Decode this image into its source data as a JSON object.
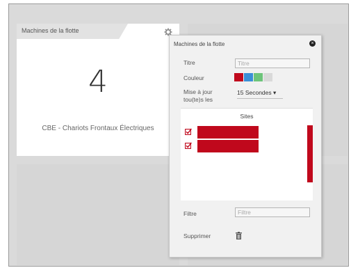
{
  "widget": {
    "title": "Machines de la flotte",
    "value": "4",
    "caption": "CBE - Chariots Frontaux Électriques",
    "settings_icon": "gear-icon"
  },
  "settings": {
    "title": "Machines de la flotte",
    "close_icon": "close-icon",
    "fields": {
      "titre_label": "Titre",
      "titre_placeholder": "Titre",
      "couleur_label": "Couleur",
      "update_label_line1": "Mise à jour",
      "update_label_line2": "tou(te)s les",
      "update_value": "15 Secondes ▾",
      "filtre_label": "Filtre",
      "filtre_placeholder": "Filtre",
      "supprimer_label": "Supprimer",
      "delete_icon": "trash-icon"
    },
    "colors": [
      "#c0081c",
      "#3a8fd6",
      "#6dc47a",
      "#d9d9d9"
    ],
    "sites": {
      "header": "Sites",
      "items": [
        {
          "checked": true,
          "name_redacted": true
        },
        {
          "checked": true,
          "name_redacted": true
        }
      ]
    }
  },
  "accent": "#c0081c"
}
